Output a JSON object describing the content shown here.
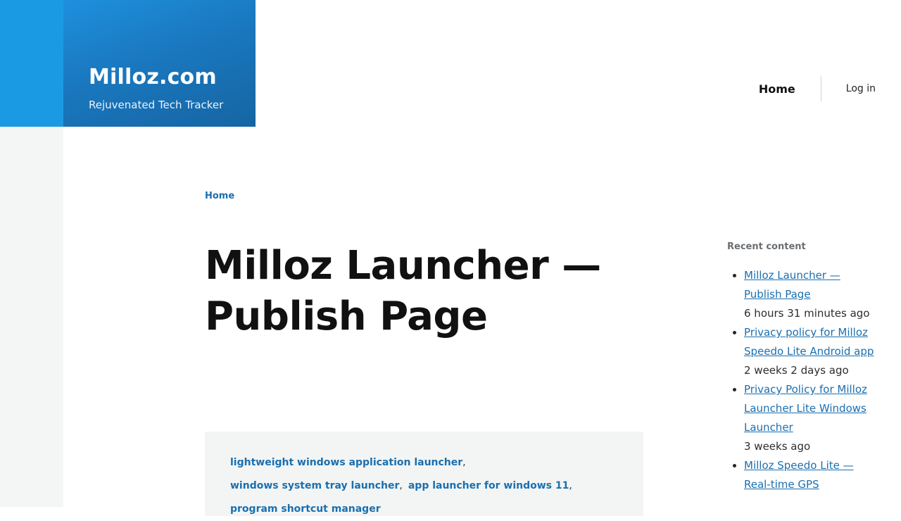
{
  "site": {
    "name": "Milloz.com",
    "slogan": "Rejuvenated Tech Tracker"
  },
  "nav": {
    "home_label": "Home",
    "login_label": "Log in"
  },
  "breadcrumb": {
    "home_label": "Home"
  },
  "page": {
    "title_line1": "Milloz Launcher —",
    "title_line2": "Publish Page"
  },
  "tags": [
    "lightweight windows application launcher",
    "windows system tray launcher",
    "app launcher for windows 11",
    "program shortcut manager"
  ],
  "sidebar": {
    "title": "Recent content",
    "items": [
      {
        "title": "Milloz Launcher — Publish Page",
        "time": "6 hours 31 minutes ago"
      },
      {
        "title": "Privacy policy for Milloz Speedo Lite Android app",
        "time": "2 weeks 2 days ago"
      },
      {
        "title": "Privacy Policy for Milloz Launcher Lite Windows Launcher",
        "time": "3 weeks ago"
      },
      {
        "title": "Milloz Speedo Lite — Real-time GPS",
        "time": ""
      }
    ]
  }
}
